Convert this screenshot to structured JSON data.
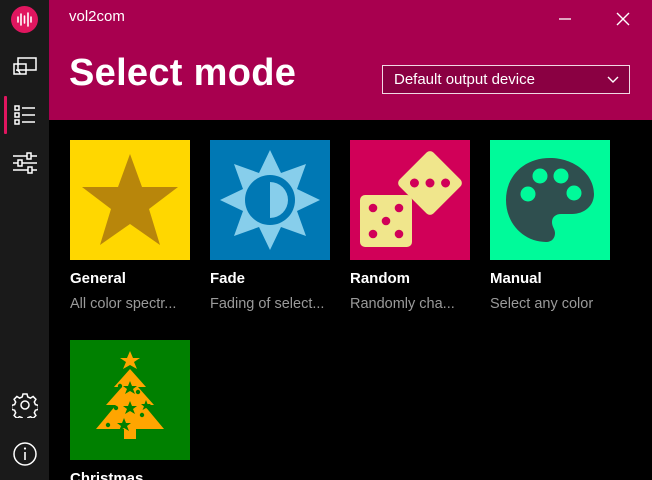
{
  "app": {
    "title": "vol2com"
  },
  "header": {
    "title": "Select mode"
  },
  "device_select": {
    "selected": "Default output device"
  },
  "modes": [
    {
      "name": "General",
      "description": "All color spectr...",
      "color": "#ffd700",
      "icon": "star-icon"
    },
    {
      "name": "Fade",
      "description": "Fading of select...",
      "color": "#0078b4",
      "icon": "brightness-icon"
    },
    {
      "name": "Random",
      "description": "Randomly cha...",
      "color": "#d10058",
      "icon": "dice-icon"
    },
    {
      "name": "Manual",
      "description": "Select any color",
      "color": "#00fa9a",
      "icon": "palette-icon"
    },
    {
      "name": "Christmas",
      "description": "",
      "color": "#008000",
      "icon": "christmas-tree-icon"
    }
  ],
  "theme": {
    "accent": "#e0165f",
    "header_bg": "#a8004f",
    "sidebar_bg": "#1a1a1a"
  }
}
